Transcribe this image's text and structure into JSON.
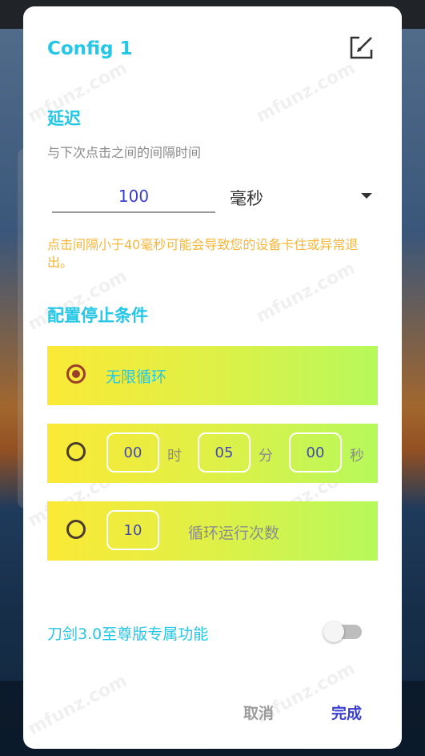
{
  "dialog": {
    "title": "Config 1",
    "edit_icon": "edit-icon"
  },
  "delay": {
    "heading": "延迟",
    "subtitle": "与下次点击之间的间隔时间",
    "value": "100",
    "unit": "毫秒",
    "warning": "点击间隔小于40毫秒可能会导致您的设备卡住或异常退出。"
  },
  "stop": {
    "heading": "配置停止条件",
    "options": [
      {
        "label": "无限循环",
        "selected": true
      },
      {
        "hours": "00",
        "hours_unit": "时",
        "minutes": "05",
        "minutes_unit": "分",
        "seconds": "00",
        "seconds_unit": "秒",
        "selected": false
      },
      {
        "count": "10",
        "count_label": "循环运行次数",
        "selected": false
      }
    ]
  },
  "premium": {
    "label": "刀剑3.0至尊版专属功能",
    "enabled": false
  },
  "actions": {
    "cancel": "取消",
    "done": "完成"
  },
  "watermark": "mfunz.com",
  "colors": {
    "accent": "#25c7e6",
    "primary": "#3a3ed0",
    "warning": "#f5b63a",
    "radio_checked": "#9a3f2a"
  }
}
